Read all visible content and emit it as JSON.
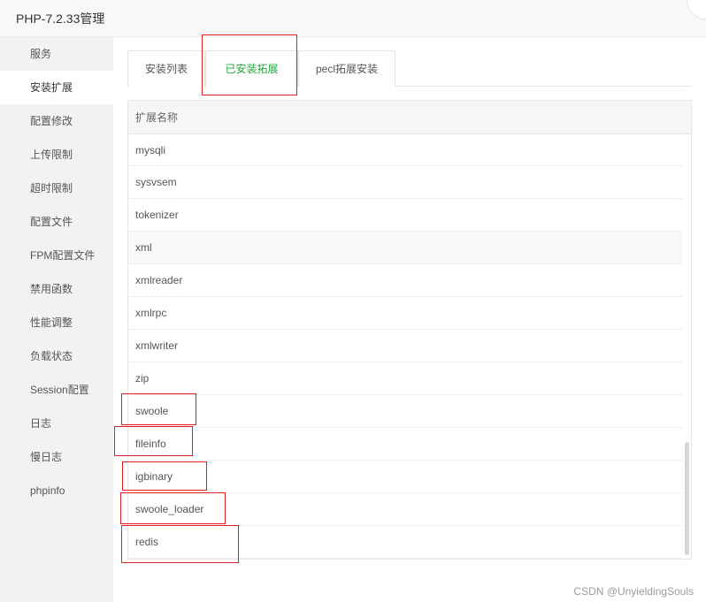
{
  "window": {
    "title": "PHP-7.2.33管理"
  },
  "sidebar": {
    "items": [
      {
        "label": "服务"
      },
      {
        "label": "安装扩展"
      },
      {
        "label": "配置修改"
      },
      {
        "label": "上传限制"
      },
      {
        "label": "超时限制"
      },
      {
        "label": "配置文件"
      },
      {
        "label": "FPM配置文件"
      },
      {
        "label": "禁用函数"
      },
      {
        "label": "性能调整"
      },
      {
        "label": "负载状态"
      },
      {
        "label": "Session配置"
      },
      {
        "label": "日志"
      },
      {
        "label": "慢日志"
      },
      {
        "label": "phpinfo"
      }
    ],
    "active_index": 1
  },
  "tabs": [
    {
      "label": "安装列表"
    },
    {
      "label": "已安装拓展"
    },
    {
      "label": "pecl拓展安装"
    }
  ],
  "table": {
    "header": "扩展名称",
    "rows": [
      "mysqli",
      "sysvsem",
      "tokenizer",
      "xml",
      "xmlreader",
      "xmlrpc",
      "xmlwriter",
      "zip",
      "swoole",
      "fileinfo",
      "igbinary",
      "swoole_loader",
      "redis"
    ]
  },
  "watermark": "CSDN @UnyieldingSouls",
  "colors": {
    "accent": "#20a53a",
    "highlight": "#e02020"
  }
}
